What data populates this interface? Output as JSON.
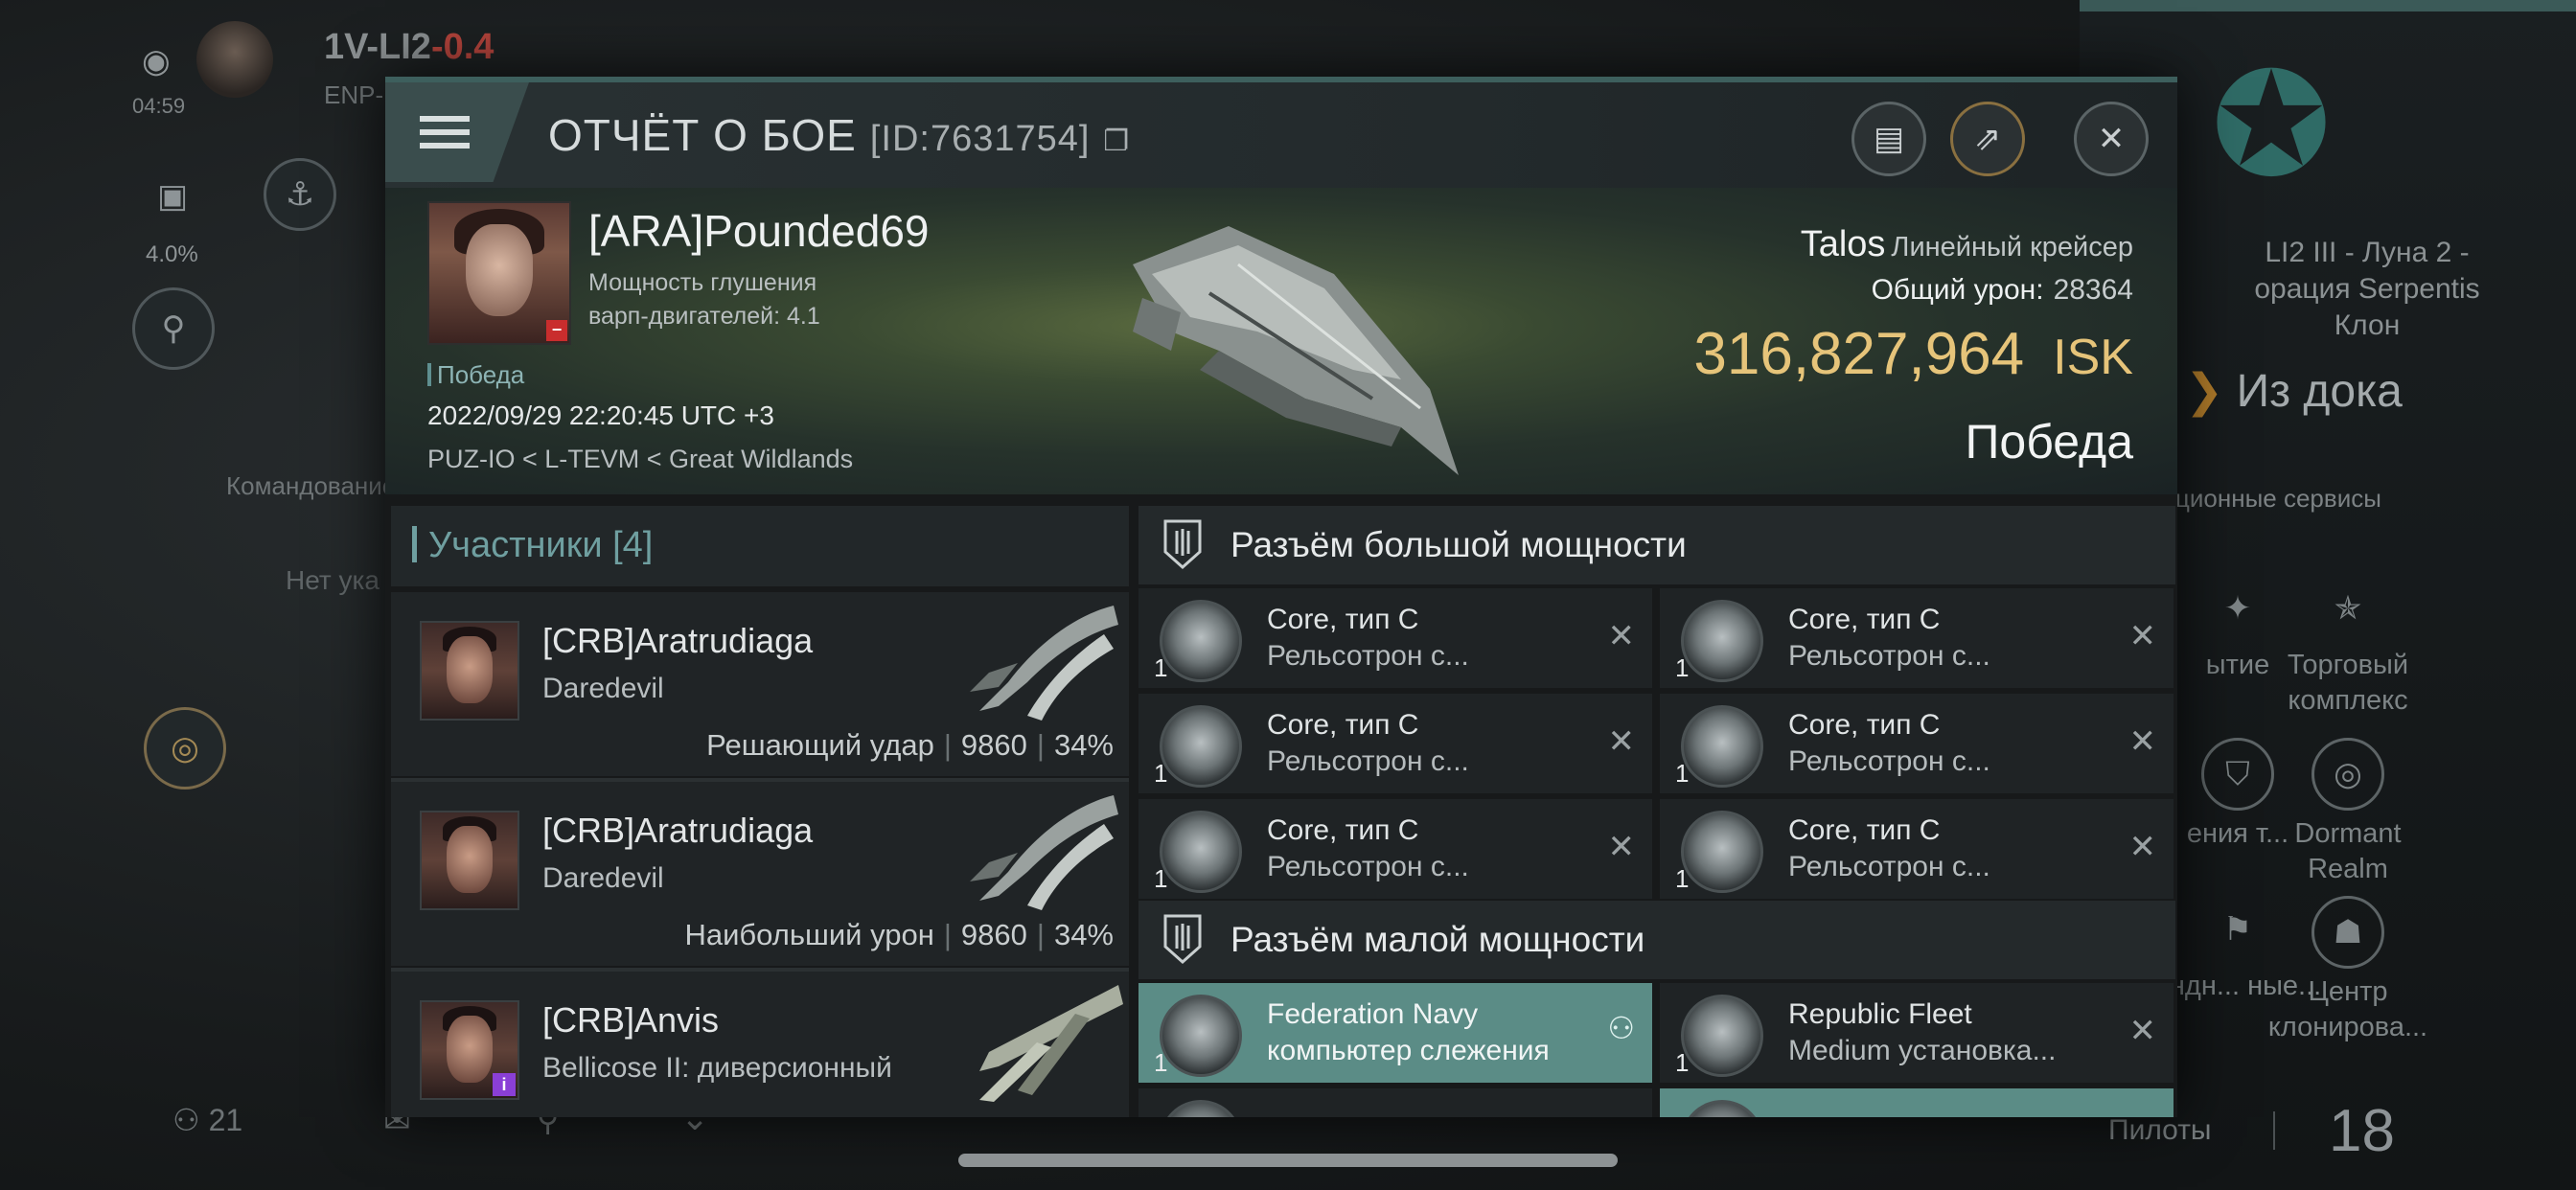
{
  "background": {
    "system": "1V-LI2",
    "security": "-0.4",
    "system_sub": "ENP-",
    "time": "04:59",
    "percent": "4.0%",
    "fleet_text": "Командование флотом",
    "no_data": "Нет ука",
    "location_lines": [
      "LI2 III - Луна 2 -",
      "орация Serpentis",
      "Клон"
    ],
    "undock": "Из дока",
    "services_label": "ционные сервисы",
    "services": [
      {
        "label": "ытие",
        "icon": "star-icon"
      },
      {
        "label": "Торговый комплекс",
        "icon": "nes-icon"
      },
      {
        "label": "ения т...",
        "icon": "shield-icon"
      },
      {
        "label": "Dormant Realm",
        "icon": "portal-icon"
      },
      {
        "label": "андн... ные...",
        "icon": "flag-icon"
      },
      {
        "label": "Центр клонирова...",
        "icon": "clone-icon"
      }
    ],
    "local_count": "21",
    "pilots_label": "Пилоты",
    "pilots_count": "18"
  },
  "modal": {
    "title": "ОТЧЁТ О БОЕ",
    "id": "[ID:7631754]",
    "victim": {
      "name": "[ARA]Pounded69",
      "stat_line1": "Мощность глушения",
      "stat_line2": "варп-двигателей: 4.1",
      "result_tag": "Победа",
      "datetime": "2022/09/29 22:20:45 UTC +3",
      "location": "PUZ-IO < L-TEVM < Great Wildlands",
      "ship": "Talos",
      "ship_class": "Линейный крейсер",
      "damage_label": "Общий урон:",
      "damage": "28364",
      "isk_value": "316,827,964",
      "isk_unit": "ISK",
      "result": "Победа"
    },
    "participants": {
      "title": "Участники [4]",
      "rows": [
        {
          "name": "[CRB]Aratrudiaga",
          "ship": "Daredevil",
          "role": "Решающий удар",
          "damage": "9860",
          "pct": "34%"
        },
        {
          "name": "[CRB]Aratrudiaga",
          "ship": "Daredevil",
          "role": "Наибольший урон",
          "damage": "9860",
          "pct": "34%"
        },
        {
          "name": "[CRB]Anvis",
          "ship": "Bellicose II: диверсионный",
          "role": "",
          "damage": "",
          "pct": ""
        }
      ]
    },
    "high_slots": {
      "title": "Разъём большой мощности",
      "items": [
        {
          "qty": "1",
          "l1": "Core, тип C",
          "l2": "Рельсотрон с..."
        },
        {
          "qty": "1",
          "l1": "Core, тип C",
          "l2": "Рельсотрон с..."
        },
        {
          "qty": "1",
          "l1": "Core, тип C",
          "l2": "Рельсотрон с..."
        },
        {
          "qty": "1",
          "l1": "Core, тип C",
          "l2": "Рельсотрон с..."
        },
        {
          "qty": "1",
          "l1": "Core, тип C",
          "l2": "Рельсотрон с..."
        },
        {
          "qty": "1",
          "l1": "Core, тип C",
          "l2": "Рельсотрон с..."
        }
      ]
    },
    "low_slots": {
      "title": "Разъём малой мощности",
      "items": [
        {
          "qty": "1",
          "l1": "Federation Navy",
          "l2": "компьютер слежения"
        },
        {
          "qty": "1",
          "l1": "Republic Fleet",
          "l2": "Medium установка..."
        }
      ]
    }
  }
}
